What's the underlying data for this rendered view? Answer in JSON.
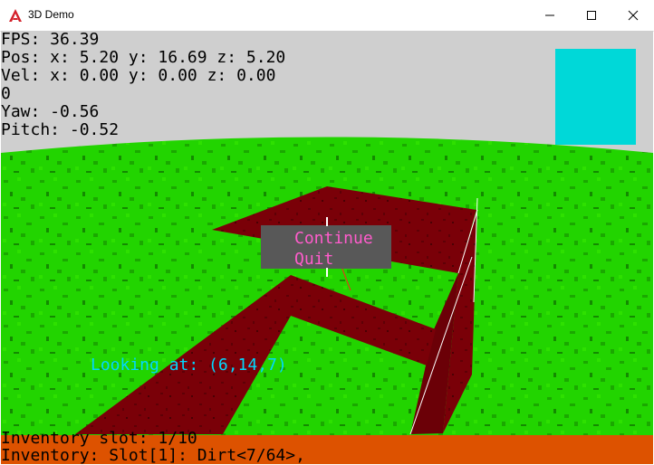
{
  "window": {
    "title": "3D Demo",
    "icons": {
      "app": "red-a-logo-icon",
      "minimize": "minimize-icon",
      "maximize": "maximize-icon",
      "close": "close-icon"
    }
  },
  "hud": {
    "fps": "FPS: 36.39",
    "pos": "Pos: x: 5.20 y: 16.69 z: 5.20",
    "vel": "Vel: x: 0.00 y: 0.00 z: 0.00",
    "extra": "0",
    "yaw": "Yaw: -0.56",
    "pitch": "Pitch: -0.52"
  },
  "menu": {
    "items": [
      "Continue",
      "Quit"
    ]
  },
  "looking_at": "Looking at: (6,14,7)",
  "inventory": {
    "slot": "Inventory slot: 1/10",
    "contents": "Inventory: Slot[1]: Dirt<7/64>,"
  },
  "colors": {
    "sky": "#cfcfcf",
    "grass": "#22d400",
    "dirt": "#7a0008",
    "minimap": "#00d8d8",
    "menu_bg": "#585858",
    "menu_text": "#ff5ccc",
    "looking_text": "#00d8ff",
    "inventory_bar": "#dd5200"
  }
}
